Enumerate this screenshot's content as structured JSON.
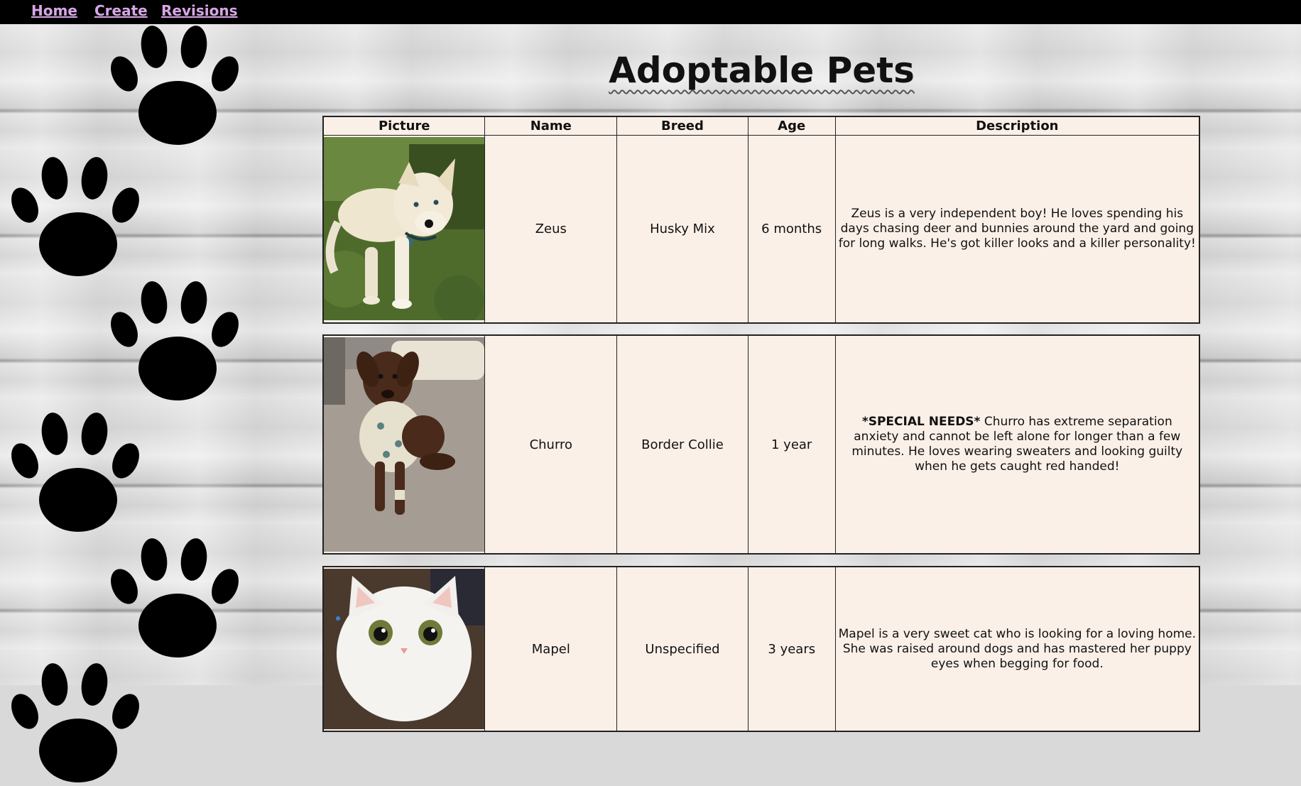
{
  "nav": {
    "links": [
      "Home",
      "Create",
      "Revisions"
    ]
  },
  "colors": {
    "nav_bg": "#000000",
    "nav_link": "#d7a6e6",
    "table_bg": "#fbf0e8"
  },
  "page": {
    "title": "Adoptable Pets"
  },
  "table": {
    "headers": [
      "Picture",
      "Name",
      "Breed",
      "Age",
      "Description"
    ]
  },
  "pets": [
    {
      "name": "Zeus",
      "breed": "Husky Mix",
      "age": "6 months",
      "description": "Zeus is a very independent boy! He loves spending his days chasing deer and bunnies around the yard and going for long walks. He's got killer looks and a killer personality!",
      "photo": "white-puppy-photo"
    },
    {
      "name": "Churro",
      "breed": "Border Collie",
      "age": "1 year",
      "description_emphasis": "*SPECIAL NEEDS*",
      "description": "Churro has extreme separation anxiety and cannot be left alone for longer than a few minutes. He loves wearing sweaters and looking guilty when he gets caught red handed!",
      "photo": "brown-dog-photo"
    },
    {
      "name": "Mapel",
      "breed": "Unspecified",
      "age": "3 years",
      "description": "Mapel is a very sweet cat who is looking for a loving home. She was raised around dogs and has mastered her puppy eyes when begging for food.",
      "photo": "white-cat-photo"
    }
  ]
}
